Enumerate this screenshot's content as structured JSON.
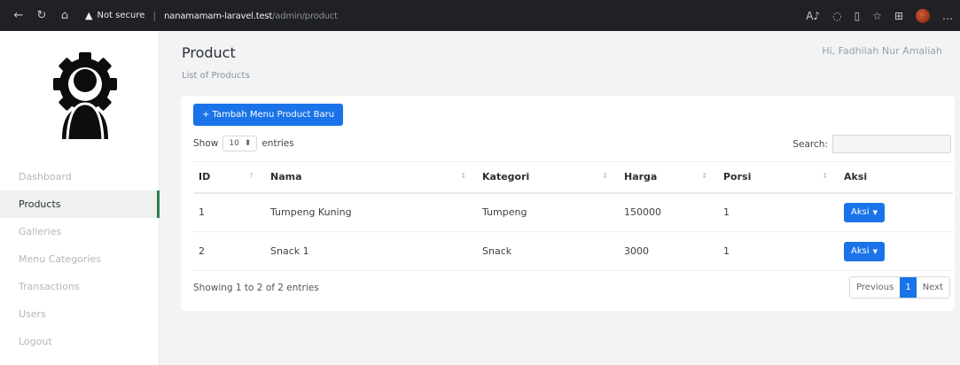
{
  "browser": {
    "security_label": "Not secure",
    "url_host": "nanamamam-laravel.test",
    "url_path": "/admin/product"
  },
  "sidebar": {
    "items": [
      {
        "label": "Dashboard"
      },
      {
        "label": "Products"
      },
      {
        "label": "Galleries"
      },
      {
        "label": "Menu Categories"
      },
      {
        "label": "Transactions"
      },
      {
        "label": "Users"
      },
      {
        "label": "Logout"
      }
    ],
    "active_index": 1
  },
  "header": {
    "title": "Product",
    "subtitle": "List of Products",
    "greeting": "Hi, Fadhilah Nur Amaliah"
  },
  "card": {
    "add_button": "+ Tambah Menu Product Baru",
    "show_label": "Show",
    "entries_value": "10",
    "entries_label": "entries",
    "search_label": "Search:",
    "search_placeholder": "",
    "columns": [
      "ID",
      "Nama",
      "Kategori",
      "Harga",
      "Porsi",
      "Aksi"
    ],
    "rows": [
      {
        "id": "1",
        "nama": "Tumpeng Kuning",
        "kategori": "Tumpeng",
        "harga": "150000",
        "porsi": "1",
        "aksi": "Aksi"
      },
      {
        "id": "2",
        "nama": "Snack 1",
        "kategori": "Snack",
        "harga": "3000",
        "porsi": "1",
        "aksi": "Aksi"
      }
    ],
    "info": "Showing 1 to 2 of 2 entries",
    "pagination": {
      "previous": "Previous",
      "current": "1",
      "next": "Next"
    }
  },
  "colors": {
    "primary": "#1a73e8",
    "active_border": "#2e7d4f",
    "page_bg": "#f2f3f5"
  },
  "icons": [
    "back-arrow-icon",
    "refresh-icon",
    "home-icon",
    "warning-icon",
    "read-aloud-icon",
    "favorites-icon",
    "gear-user-logo-icon",
    "sort-icon",
    "caret-down-icon"
  ]
}
